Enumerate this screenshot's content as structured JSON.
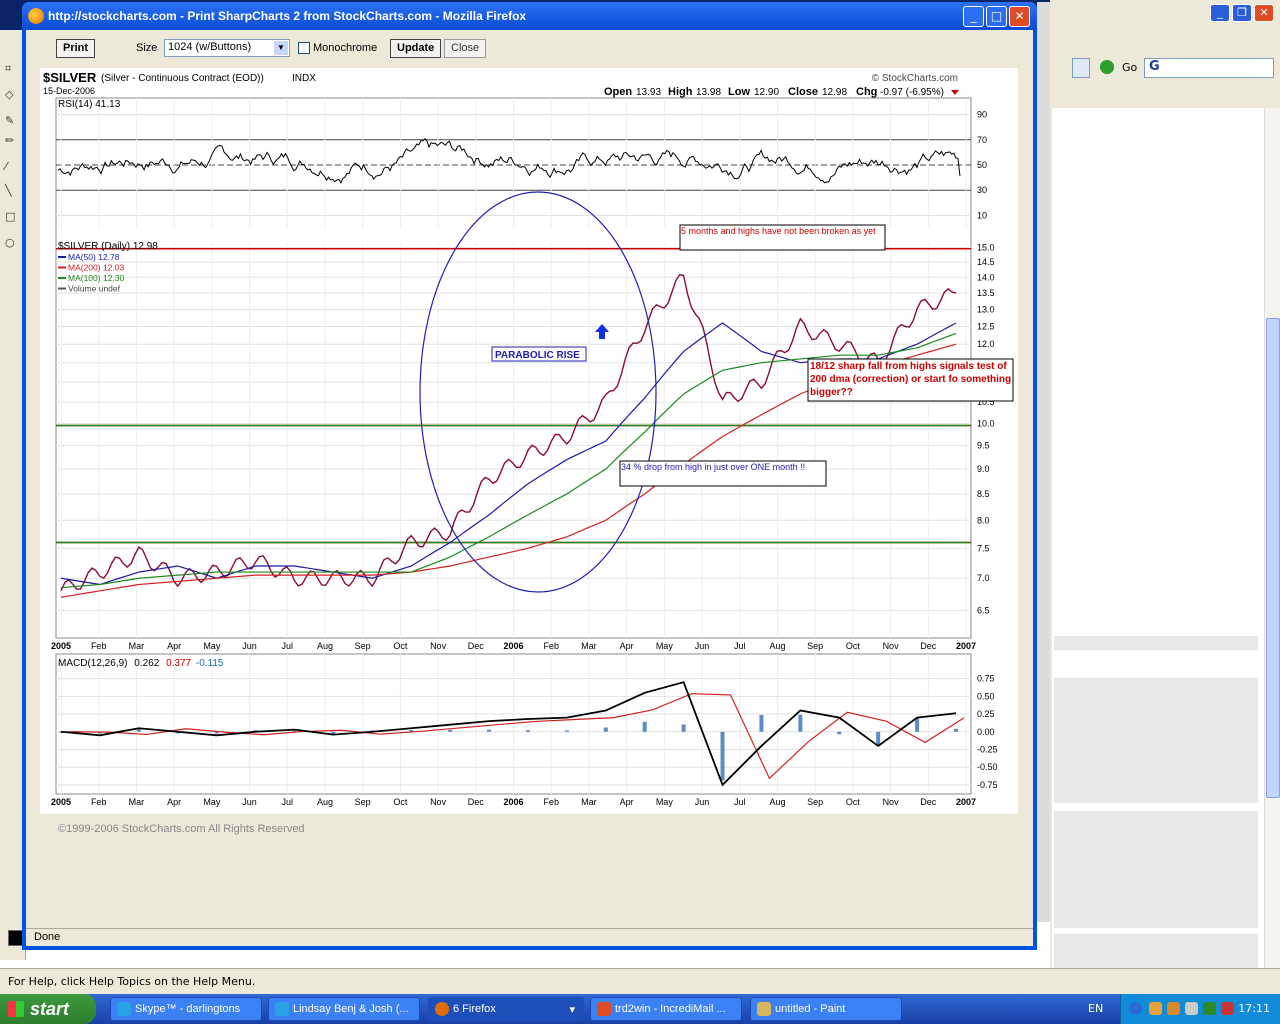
{
  "paint": {
    "status_help": "For Help, click Help Topics on the Help Menu."
  },
  "behind_browser": {
    "go_label": "Go",
    "search_value": "G"
  },
  "firefox": {
    "title": "http://stockcharts.com - Print SharpCharts 2 from StockCharts.com - Mozilla Firefox",
    "status": "Done",
    "toolbar": {
      "print_label": "Print",
      "size_label": "Size",
      "size_value": "1024 (w/Buttons)",
      "monochrome_label": "Monochrome",
      "update_label": "Update",
      "close_label": "Close"
    },
    "copyright": "©1999-2006 StockCharts.com All Rights Reserved"
  },
  "chart_header": {
    "symbol": "$SILVER",
    "name": "(Silver - Continuous Contract (EOD))",
    "exchange": "INDX",
    "brand": "© StockCharts.com",
    "date": "15-Dec-2006",
    "open_label": "Open",
    "open": "13.93",
    "high_label": "High",
    "high": "13.98",
    "low_label": "Low",
    "low": "12.90",
    "close_label": "Close",
    "close": "12.98",
    "chg_label": "Chg",
    "chg": "-0.97 (-6.95%)"
  },
  "chart_data": [
    {
      "type": "line",
      "panel": "rsi",
      "title": "RSI(14) 41.13",
      "yticks": [
        "90",
        "70",
        "50",
        "30",
        "10"
      ],
      "ylim": [
        0,
        100
      ],
      "reference_lines": [
        70,
        50,
        30
      ],
      "series": [
        {
          "name": "RSI(14)",
          "last": 41.13
        }
      ]
    },
    {
      "type": "line",
      "panel": "price",
      "title": "$SILVER (Daily) 12.98",
      "legend": [
        "MA(50) 12.78",
        "MA(200) 12.03",
        "MA(100) 12.30",
        "Volume undef"
      ],
      "legend_colors": [
        "#1a1aa8",
        "#d22020",
        "#1c8a1c",
        "#555555"
      ],
      "xticks": [
        "2005",
        "Feb",
        "Mar",
        "Apr",
        "May",
        "Jun",
        "Jul",
        "Aug",
        "Sep",
        "Oct",
        "Nov",
        "Dec",
        "2006",
        "Feb",
        "Mar",
        "Apr",
        "May",
        "Jun",
        "Jul",
        "Aug",
        "Sep",
        "Oct",
        "Nov",
        "Dec",
        "2007"
      ],
      "yticks": [
        "15.0",
        "14.5",
        "14.0",
        "13.5",
        "13.0",
        "12.5",
        "12.0",
        "11.5",
        "11.0",
        "10.5",
        "10.0",
        "9.5",
        "9.0",
        "8.5",
        "8.0",
        "7.5",
        "7.0",
        "6.5"
      ],
      "ylim": [
        6.1,
        15.15
      ],
      "scale": "log",
      "x": [
        "2005-01",
        "2005-02",
        "2005-03",
        "2005-04",
        "2005-05",
        "2005-06",
        "2005-07",
        "2005-08",
        "2005-09",
        "2005-10",
        "2005-11",
        "2005-12",
        "2006-01",
        "2006-02",
        "2006-03",
        "2006-04",
        "2006-05",
        "2006-06",
        "2006-07",
        "2006-08",
        "2006-09",
        "2006-10",
        "2006-11",
        "2006-12"
      ],
      "series": [
        {
          "name": "$SILVER",
          "values": [
            6.8,
            7.1,
            7.4,
            7.0,
            7.1,
            7.3,
            7.0,
            7.0,
            7.0,
            7.6,
            7.8,
            8.8,
            9.3,
            9.7,
            10.5,
            12.5,
            14.0,
            10.5,
            11.0,
            12.5,
            12.0,
            11.5,
            13.0,
            13.5
          ]
        },
        {
          "name": "MA(50)",
          "values": [
            7.0,
            6.9,
            7.1,
            7.2,
            7.0,
            7.2,
            7.2,
            7.1,
            7.0,
            7.2,
            7.6,
            8.1,
            8.7,
            9.2,
            9.6,
            10.6,
            11.8,
            12.6,
            11.8,
            11.5,
            11.6,
            11.6,
            12.0,
            12.6
          ]
        },
        {
          "name": "MA(200)",
          "values": [
            6.7,
            6.8,
            6.9,
            6.95,
            7.0,
            7.05,
            7.05,
            7.05,
            7.05,
            7.1,
            7.2,
            7.35,
            7.5,
            7.7,
            8.0,
            8.5,
            9.1,
            9.7,
            10.2,
            10.7,
            11.1,
            11.4,
            11.7,
            12.0
          ]
        },
        {
          "name": "MA(100)",
          "values": [
            6.85,
            6.9,
            7.0,
            7.05,
            7.1,
            7.1,
            7.1,
            7.1,
            7.1,
            7.1,
            7.35,
            7.7,
            8.1,
            8.5,
            9.0,
            9.8,
            10.7,
            11.3,
            11.5,
            11.6,
            11.7,
            11.7,
            11.9,
            12.3
          ]
        }
      ],
      "horizontal_lines": [
        {
          "value": 14.95,
          "color": "#cc0000"
        },
        {
          "value": 9.95,
          "color": "#cc0000"
        },
        {
          "value": 9.95,
          "color": "#1c8a1c"
        },
        {
          "value": 7.6,
          "color": "#cc0000"
        },
        {
          "value": 7.6,
          "color": "#1c8a1c"
        }
      ]
    },
    {
      "type": "line",
      "panel": "macd",
      "title_prefix": "MACD(12,26,9)",
      "title_values": [
        "0.262",
        "0.377",
        "-0.115"
      ],
      "yticks": [
        "0.75",
        "0.50",
        "0.25",
        "0.00",
        "-0.25",
        "-0.50",
        "-0.75"
      ],
      "ylim": [
        -0.85,
        0.9
      ],
      "xticks": [
        "2005",
        "Feb",
        "Mar",
        "Apr",
        "May",
        "Jun",
        "Jul",
        "Aug",
        "Sep",
        "Oct",
        "Nov",
        "Dec",
        "2006",
        "Feb",
        "Mar",
        "Apr",
        "May",
        "Jun",
        "Jul",
        "Aug",
        "Sep",
        "Oct",
        "Nov",
        "Dec",
        "2007"
      ],
      "series": [
        {
          "name": "MACD",
          "last": 0.262
        },
        {
          "name": "Signal",
          "last": 0.377
        },
        {
          "name": "Histogram",
          "last": -0.115
        }
      ]
    }
  ],
  "annotations": {
    "highs_note": "5 months and highs have not been broken as yet",
    "parabolic": "PARABOLIC RISE",
    "drop_note": "34 % drop from high in just over ONE month !!",
    "fall_note": "18/12 sharp fall from highs signals test of 200 dma (correction) or start fo something bigger??"
  },
  "taskbar": {
    "start_label": "start",
    "tasks": [
      "Skype™ - darlingtons",
      "Lindsay Benj & Josh (...",
      "6 Firefox",
      "trd2win - IncrediMail ...",
      "untitled - Paint"
    ],
    "lang": "EN",
    "clock": "17:11"
  }
}
